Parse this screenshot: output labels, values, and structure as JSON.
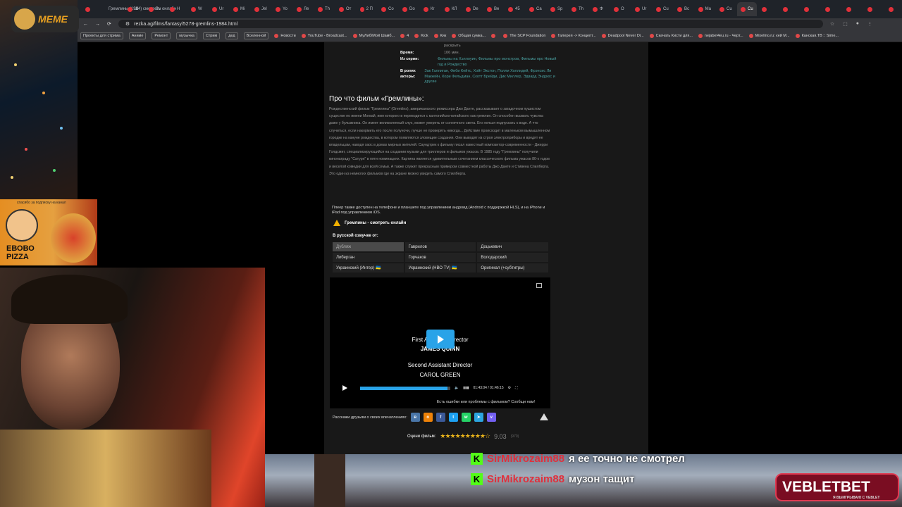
{
  "browser": {
    "tabs": [
      "",
      "Гремлины (1984) смотреть онлайн",
      "Ш",
      "Bv",
      "Н",
      "W",
      "Ur",
      "Mi",
      "Jel",
      "Yo",
      "Ле",
      "Th",
      "Oт",
      "2 П",
      "Co",
      "Do",
      "Кr",
      "КЛ",
      "De",
      "Вe",
      "45",
      "Ca",
      "Sp",
      "Th",
      "Ф",
      "О",
      "Ur",
      "Cu",
      "Вс",
      "Ma",
      "Cu",
      "Cu",
      "",
      "",
      "",
      "",
      "",
      "",
      ""
    ],
    "active_tab_index": 31,
    "url": "rezka.ag/films/fantasy/5278-gremlins-1984.html",
    "bookmarks": [
      "Проекты для стрима",
      "Аниме",
      "Ремонт",
      "музычка",
      "Стрим",
      "дед",
      "Вселенной",
      "Новости",
      "YouTube - Broadcast...",
      "МуЛиб/Мой Шамб...",
      "4",
      "Kick",
      "Кик",
      "Общая сумка...",
      "",
      "The SCP Foundation",
      "Галерея -> Концепт...",
      "Deadpool Never Di...",
      "Скачать Кисти для...",
      "nejabet4eu.ru - Черт...",
      "Mixelino.ru: кей М...",
      "Канская.ТВ :: Sime..."
    ],
    "window_icons": [
      "—",
      "□",
      "✕"
    ]
  },
  "film": {
    "info_rows": [
      {
        "k": "",
        "v": "раскрыть"
      },
      {
        "k": "Время:",
        "v": "106 мин."
      },
      {
        "k": "Из серии:",
        "v": "Фильмы на Хэллоуин, Фильмы про монстров, Фильмы про Новый год и Рождество"
      },
      {
        "k": "В ролях актеры:",
        "v": "Зак Галлиган, Фиби Кейтс, Хойт Экстон, Полли Холлидей, Фрэнсис Ли Маккейн, Кори Фельдман, Скотт Брейди, Дик Миллер, Эдвард Эндрюс и другие"
      }
    ],
    "about_title": "Про что фильм «Гремлины»:",
    "about_text": "Рождественский фильм \"Гремлины\" (Gremlins), американского режиссера Джо Данте, рассказывает о загадочном пушистом существе по имени Могвай, имя которого в переводится с кантонийско-китайского как гремлин. Он способен вызвать чувства даже у булыжника. Он имеет великолепный слух, может умереть от солнечного света. Его нельзя подпускать к воде. А что случиться, если накормить его после полуночи, лучше не проверять никогда... Действие происходит в маленьком вымышленном городке на кануне рождества, в котором появляются зловещие создания. Они выводят из строя электроприборы и вредят ее владельцам, наводя хаос в домах мирных жителей. Саундтрек к фильму писал известный композитор-современности - Джерри Голдсмит, специализирующийся на создании музыки для триллеров и фильмов ужасов. В 1985 году \"Гремлины\" получили кинонаграду \"Сатурн\" в пяти номинациях. Картина является удивительным сочетанием классического фильма ужасов 80-х годов и веселой комедии для всей семьи. А также служит прекрасным примером совместной работы Джо Данте и Стивена Спилберга. Это один из немногих фильмов где на экране можно увидеть самого Спилберга."
  },
  "player": {
    "note": "Плеер также доступен на телефоне и планшете под управлением андроид (Android с поддержкой HLS), и на iPhone и iPad под управлением iOS.",
    "warning": "Гремлины - смотреть онлайн",
    "dub_title": "В русской озвучке от:",
    "dubs": [
      "Дубляж",
      "Гаврилов",
      "Доцькевич",
      "Либерган",
      "Горчаков",
      "Володарский",
      "Украинский (Интер) 🇺🇦",
      "Украинский (НВО TV) 🇺🇦",
      "Оригинал (+субтитры)"
    ],
    "active_dub": 0,
    "credits": [
      "First Assistant Director",
      "JAMES QUINN",
      "Second Assistant Director",
      "CAROL GREEN"
    ],
    "time": "01:43:04 / 01:46:15",
    "progress": 0.97,
    "report": "Есть ошибки или проблемы с фильмом? Сообщи нам!"
  },
  "share": {
    "label": "Расскажи друзьям о своих впечатлениях:",
    "networks": [
      {
        "name": "vk",
        "glyph": "в",
        "color": "#4a76a8"
      },
      {
        "name": "ok",
        "glyph": "о",
        "color": "#ee8208"
      },
      {
        "name": "facebook",
        "glyph": "f",
        "color": "#3b5998"
      },
      {
        "name": "twitter",
        "glyph": "t",
        "color": "#1da1f2"
      },
      {
        "name": "whatsapp",
        "glyph": "w",
        "color": "#25d366"
      },
      {
        "name": "telegram",
        "glyph": "➤",
        "color": "#2ca5e0"
      },
      {
        "name": "viber",
        "glyph": "v",
        "color": "#7360f2"
      }
    ]
  },
  "rating": {
    "label": "Оцени фильм:",
    "stars": 9,
    "max": 10,
    "value": "9.03",
    "count": "(970)"
  },
  "overlay": {
    "meme_logo": "MEME",
    "pizza_top": "спасибо за подписку на канал",
    "pizza_brand_1": "ЕВОВО",
    "pizza_brand_2": "PIZZA",
    "chat": [
      {
        "nick": "SirMikrozaim88",
        "msg": "я ее точно не смотрел"
      },
      {
        "nick": "SirMikrozaim88",
        "msg": "музон тащит"
      }
    ],
    "vbet": "VEBLETBET",
    "vbet_sub": "Я ВЫИГРЫВАЮ С VEBLET"
  }
}
